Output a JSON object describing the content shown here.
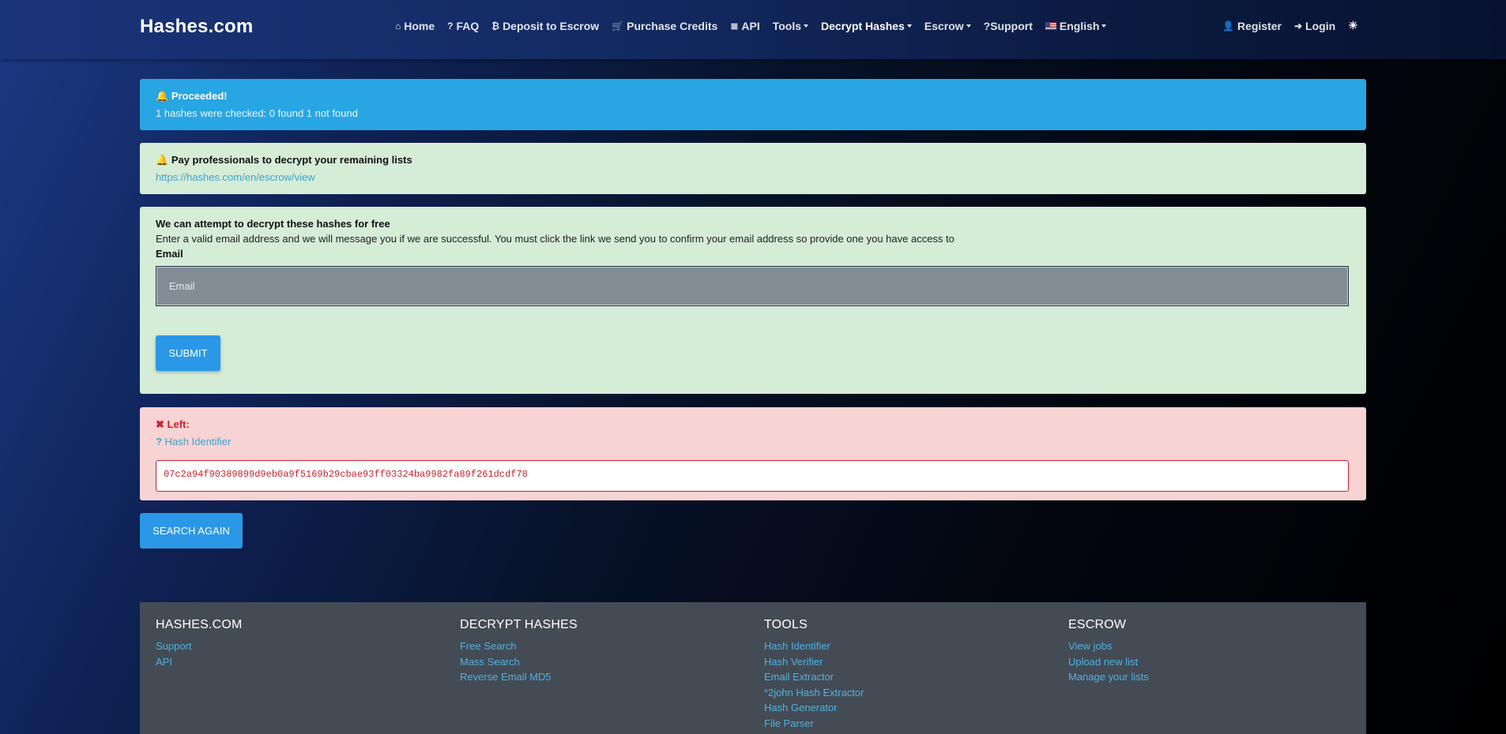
{
  "navbar": {
    "brand": "Hashes.com",
    "items": [
      {
        "icon": "home-icon",
        "glyph": "⌂",
        "label": "Home"
      },
      {
        "icon": "question-icon",
        "glyph": "?",
        "label": "FAQ"
      },
      {
        "icon": "bitcoin-icon",
        "glyph": "₿",
        "label": "Deposit to Escrow"
      },
      {
        "icon": "cart-icon",
        "glyph": "🛒",
        "label": "Purchase Credits"
      },
      {
        "icon": "api-icon",
        "glyph": "≣",
        "label": "API"
      },
      {
        "label": "Tools"
      },
      {
        "label": "Decrypt Hashes"
      },
      {
        "label": "Escrow"
      },
      {
        "label": "?Support"
      },
      {
        "label": "English"
      }
    ],
    "register": "Register",
    "login": "Login",
    "theme_glyph": "☀"
  },
  "alerts": {
    "info": {
      "title": "Proceeded!",
      "message": "1 hashes were checked: 0 found 1 not found"
    },
    "pay": {
      "title": "Pay professionals to decrypt your remaining lists",
      "link": "https://hashes.com/en/escrow/view"
    },
    "free": {
      "title": "We can attempt to decrypt these hashes for free",
      "description": "Enter a valid email address and we will message you if we are successful. You must click the link we send you to confirm your email address so provide one you have access to",
      "email_label": "Email",
      "email_placeholder": "Email",
      "submit_label": "SUBMIT"
    },
    "left": {
      "title": "Left:",
      "hash_identifier": "Hash Identifier",
      "hash": "07c2a94f90389899d9eb0a9f5169b29cbae93ff03324ba9982fa89f261dcdf78"
    }
  },
  "search_again_label": "SEARCH AGAIN",
  "footer": {
    "col1": {
      "title": "HASHES.COM",
      "links": [
        "Support",
        "API"
      ]
    },
    "col2": {
      "title": "DECRYPT HASHES",
      "links": [
        "Free Search",
        "Mass Search",
        "Reverse Email MD5"
      ]
    },
    "col3": {
      "title": "TOOLS",
      "links": [
        "Hash Identifier",
        "Hash Verifier",
        "Email Extractor",
        "*2john Hash Extractor",
        "Hash Generator",
        "File Parser"
      ]
    },
    "col4": {
      "title": "ESCROW",
      "links": [
        "View jobs",
        "Upload new list",
        "Manage your lists"
      ]
    }
  },
  "colors": {
    "info": "#27a6e3",
    "success_bg": "#d5ecd7",
    "danger_bg": "#f8d3d4",
    "danger": "#c9202b",
    "button": "#2a98e7",
    "footer_bg": "#434b55",
    "link": "#4fb3df"
  }
}
